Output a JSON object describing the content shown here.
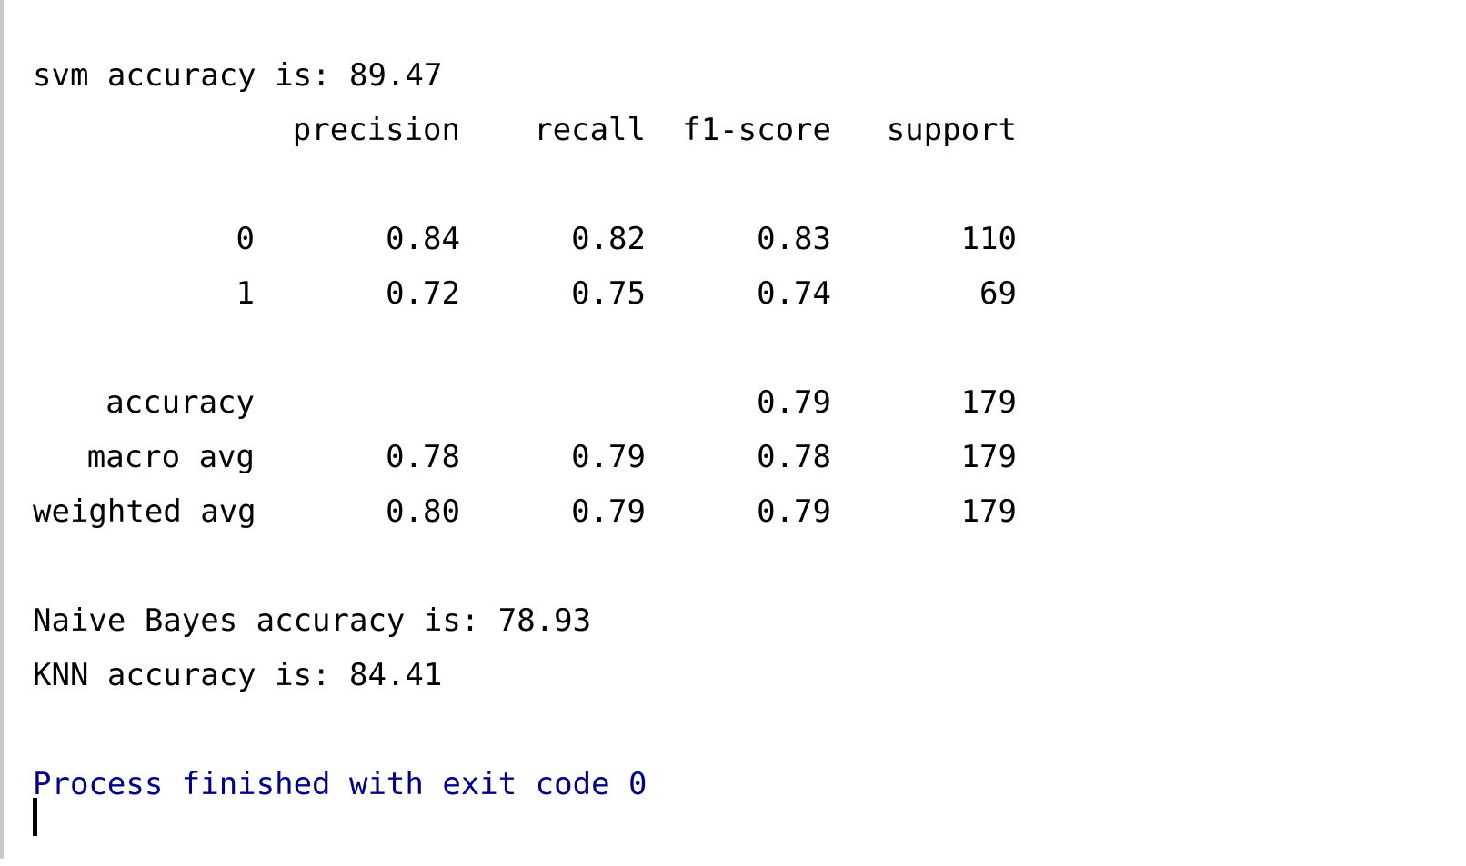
{
  "console": {
    "svm_line": "svm accuracy is: 89.47",
    "report": {
      "headers": {
        "precision": "precision",
        "recall": "recall",
        "f1": "f1-score",
        "support": "support"
      },
      "rows": [
        {
          "label": "0",
          "precision": "0.84",
          "recall": "0.82",
          "f1": "0.83",
          "support": "110"
        },
        {
          "label": "1",
          "precision": "0.72",
          "recall": "0.75",
          "f1": "0.74",
          "support": "69"
        }
      ],
      "accuracy": {
        "label": "accuracy",
        "precision": "",
        "recall": "",
        "f1": "0.79",
        "support": "179"
      },
      "macro_avg": {
        "label": "macro avg",
        "precision": "0.78",
        "recall": "0.79",
        "f1": "0.78",
        "support": "179"
      },
      "weighted_avg": {
        "label": "weighted avg",
        "precision": "0.80",
        "recall": "0.79",
        "f1": "0.79",
        "support": "179"
      }
    },
    "naive_bayes_line": "Naive Bayes accuracy is: 78.93",
    "knn_line": "KNN accuracy is: 84.41",
    "process_line": "Process finished with exit code 0"
  },
  "colors": {
    "process_text": "#00008b",
    "gutter": "#c9c9c9"
  }
}
